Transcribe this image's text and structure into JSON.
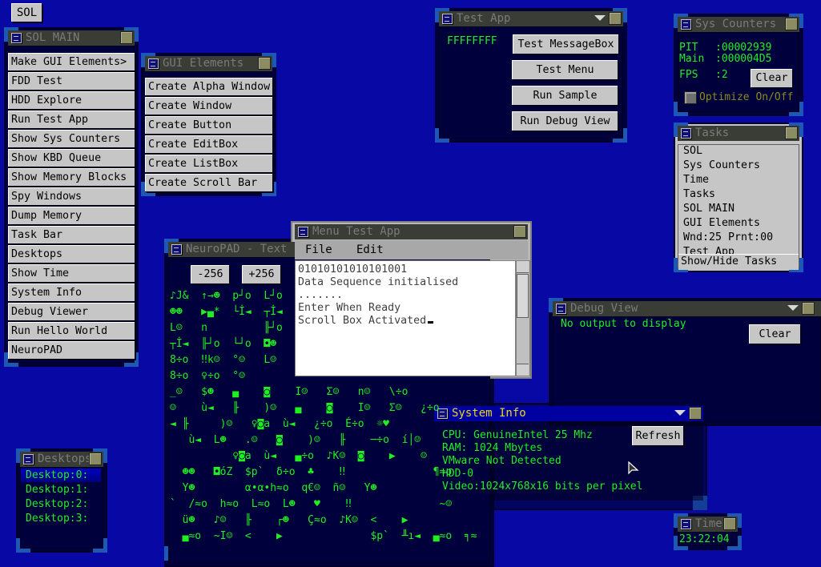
{
  "taskbar": {
    "sol_button": "SOL"
  },
  "sol_main": {
    "title": "SOL MAIN",
    "items": [
      "Make GUI Elements>",
      "FDD Test",
      "HDD Explore",
      "Run Test App",
      "Show Sys Counters",
      "Show KBD Queue",
      "Show Memory Blocks",
      "Spy Windows",
      "Dump Memory",
      "Task Bar",
      "Desktops",
      "Show Time",
      "System Info",
      "Debug Viewer",
      "Run Hello World",
      "NeuroPAD"
    ]
  },
  "gui_elements": {
    "title": "GUI Elements",
    "items": [
      "Create Alpha Window",
      "Create Window",
      "Create Button",
      "Create EditBox",
      "Create ListBox",
      "Create Scroll Bar"
    ]
  },
  "test_app": {
    "title": "Test App",
    "value": "FFFFFFFF",
    "buttons": [
      "Test MessageBox",
      "Test Menu",
      "Run Sample",
      "Run Debug View"
    ]
  },
  "sys_counters": {
    "title": "Sys Counters",
    "pit_label": "PIT",
    "pit_value": ":00002939",
    "main_label": "Main",
    "main_value": ":000004D5",
    "fps_label": "FPS",
    "fps_value": ":2",
    "clear": "Clear",
    "optimize_label": "Optimize On/Off"
  },
  "tasks": {
    "title": "Tasks",
    "items": [
      "SOL",
      "Sys Counters",
      "Time",
      "Tasks",
      "SOL MAIN",
      "GUI Elements",
      "Wnd:25 Prnt:00",
      "Test App"
    ],
    "toggle": "Show/Hide Tasks"
  },
  "debug_view": {
    "title": "Debug View",
    "message": "No output to display",
    "clear": "Clear"
  },
  "neuropad": {
    "title": "NeuroPAD - Text Editor",
    "minus": "-256",
    "plus": "+256",
    "rows": [
      "♪J&  ↑→☻  p┘o  L┘o",
      "☻☻   ▶▄*  └İ◄  ┬İ◄",
      "L☺   n         ╟┘o",
      "┬İ◄  ╟┘o  └┘o  ◘☻",
      "8÷o  ‼k☺  °☺   L☺",
      "8÷o  ♀÷o  °☺",
      "_☺   $☻   ▄    ◙    I☺   Σ☺   n☺   \\÷o",
      "☺    ù◄   ╟    )☺   ▄    ◙    I☺   Σ☺   ¿÷o",
      "◄ ╟     )☺   ♀◙a  ù◄   ¿÷o  É÷o  ☼♥",
      "   ù◄  L☻   .☺   ◙    )☺   ╟    ─÷o  í│☺",
      "          ♀◙a  ù◄   ▄÷o  ♪K☺  ◙    ▶    ☺",
      "  ☻☻   ◘óZ  $p`  δ÷o  ♣    ‼              ¶≈o",
      "  Y☻        α•α•h≈o  q€☺  ñ☺   Y☻",
      "`  /≈o  h≈o  L≈o  L☻   ♥    ‼              ~☺",
      "  ü☻   ♪☺   ╟    ┌☻   Ç≈o  ♪K☺  <    ▶",
      "  ▄≈o  ~I☺  <    ▶              $p`  ╨ı◄  ▄≈o  ╕≈"
    ]
  },
  "menu_test": {
    "title": "Menu Test App",
    "menu": [
      "File",
      "Edit"
    ],
    "lines": [
      "01010101010101001",
      "Data Sequence initialised",
      ".......",
      "Enter When Ready",
      "Scroll Box Activated"
    ]
  },
  "system_info": {
    "title": "System Info",
    "cpu": "CPU: GenuineIntel    25 Mhz",
    "ram": "RAM: 1024 Mbytes",
    "vmware": "VMware Not Detected",
    "hdd": "HDD-0",
    "video": "Video:1024x768x16 bits per pixel",
    "refresh": "Refresh"
  },
  "desktops": {
    "title": "Desktops",
    "items": [
      "Desktop:0:",
      "Desktop:1:",
      "Desktop:2:",
      "Desktop:3:"
    ],
    "selected": 0
  },
  "time": {
    "title": "Time",
    "value": "23:22:04"
  },
  "colors": {
    "desktop": "#0808a4",
    "title_inactive": "#3a3d36",
    "title_active": "#0000a0",
    "text_green": "#20f020",
    "button": "#c6c6c6"
  }
}
